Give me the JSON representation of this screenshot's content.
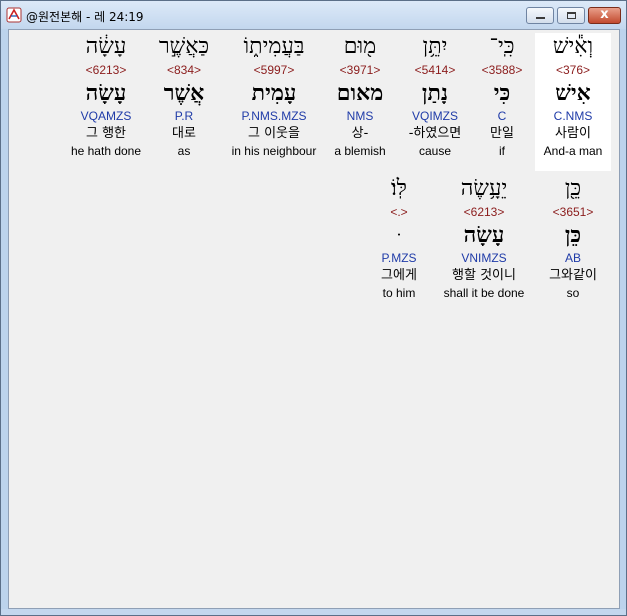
{
  "window": {
    "title": "@원전본해 - 레 24:19"
  },
  "titlebar_buttons": {
    "minimize": "minimize",
    "maximize": "maximize",
    "close": "x"
  },
  "row1": [
    {
      "hebrew": "וְאִ֕ישׁ",
      "strong": "<376>",
      "lemma": "אִישׁ",
      "morph": "C.NMS",
      "korean": "사람이",
      "english": "And-a man"
    },
    {
      "hebrew": "כִּֽי־",
      "strong": "<3588>",
      "lemma": "כִּי",
      "morph": "C",
      "korean": "만일",
      "english": "if"
    },
    {
      "hebrew": "יִתֵּ֥ן",
      "strong": "<5414>",
      "lemma": "נָתַן",
      "morph": "VQIMZS",
      "korean": "-하였으면",
      "english": "cause"
    },
    {
      "hebrew": "מ֖וּם",
      "strong": "<3971>",
      "lemma": "מאום",
      "morph": "NMS",
      "korean": "상-",
      "english": "a blemish"
    },
    {
      "hebrew": "בַּעֲמִית֑וֹ",
      "strong": "<5997>",
      "lemma": "עָמִית",
      "morph": "P.NMS.MZS",
      "korean": "그 이웃을",
      "english": "in his neighbour"
    },
    {
      "hebrew": "כַּאֲשֶׁ֣ר",
      "strong": "<834>",
      "lemma": "אֲשֶׁר",
      "morph": "P.R",
      "korean": "대로",
      "english": "as"
    },
    {
      "hebrew": "עָשָׂ֔ה",
      "strong": "<6213>",
      "lemma": "עָשָׂה",
      "morph": "VQAMZS",
      "korean": "그 행한",
      "english": "he hath done"
    }
  ],
  "row2": [
    {
      "hebrew": "כֵּ֖ן",
      "strong": "<3651>",
      "lemma": "כֵּן",
      "morph": "AB",
      "korean": "그와같이",
      "english": "so"
    },
    {
      "hebrew": "יֵעָ֥שֶׂה",
      "strong": "<6213>",
      "lemma": "עָשָׂה",
      "morph": "VNIMZS",
      "korean": "행할 것이니",
      "english": "shall it be done"
    },
    {
      "hebrew": "לּֽוֹ׃",
      "strong": "<.>",
      "lemma": "ּ",
      "morph": "P.MZS",
      "korean": "그에게",
      "english": "to him"
    }
  ]
}
